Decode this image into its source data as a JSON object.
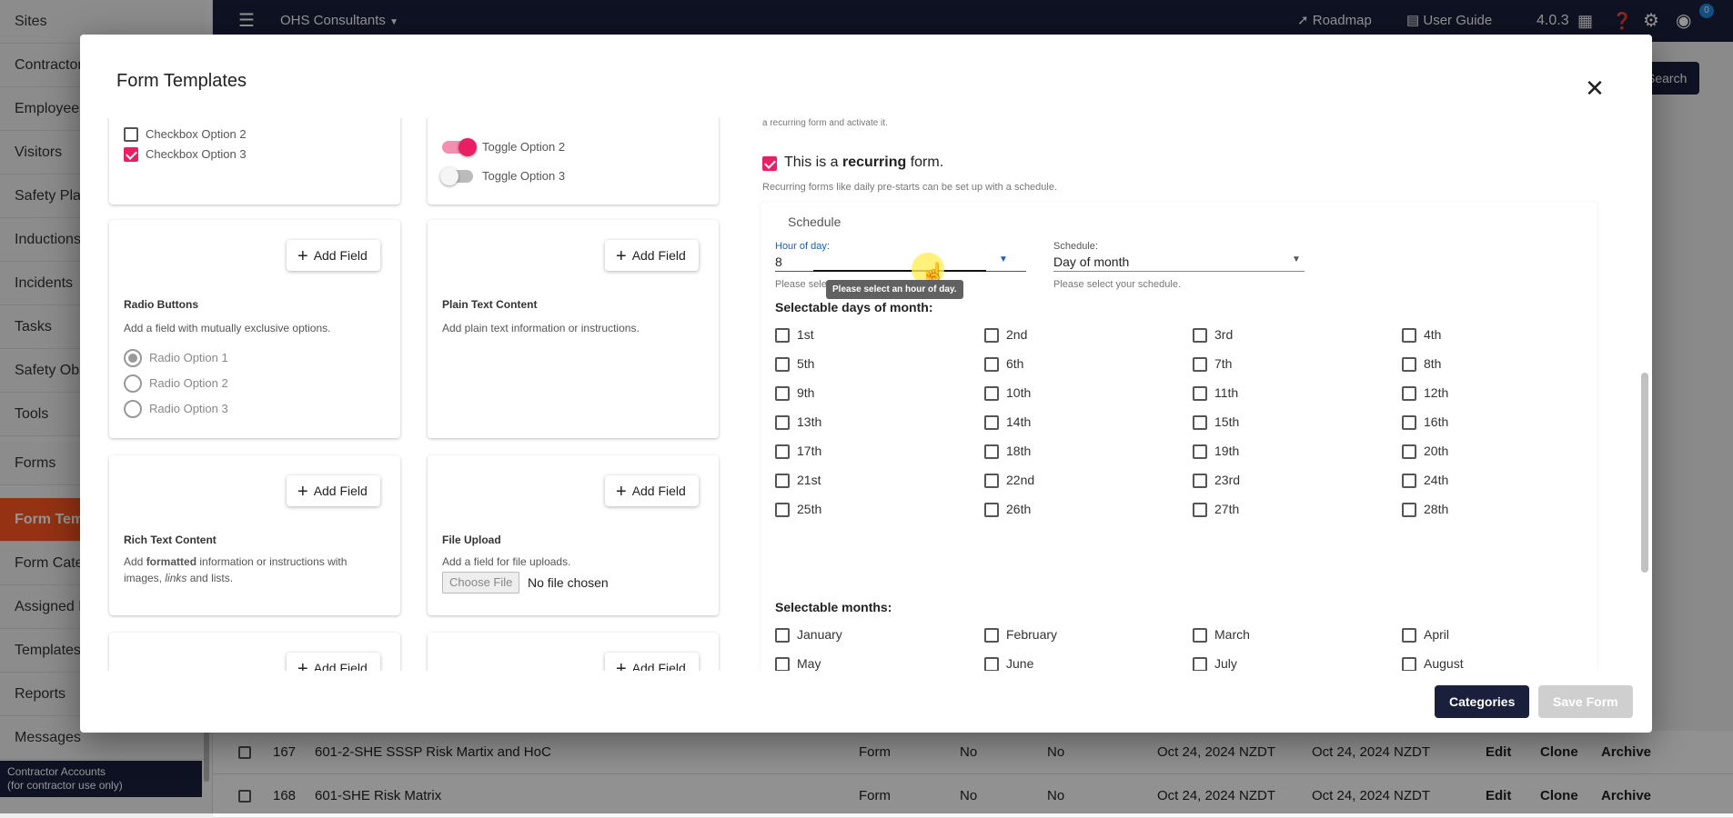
{
  "sidebar": {
    "items": [
      "Sites",
      "Contractors",
      "Employees",
      "Visitors",
      "Safety Plans",
      "Inductions",
      "Incidents",
      "Tasks",
      "Safety Observations",
      "Tools",
      "Forms",
      "Form Templates",
      "Form Categories",
      "Assigned Forms",
      "Templates",
      "Reports",
      "Messages"
    ],
    "active_index": 11,
    "footer_line1": "Contractor Accounts",
    "footer_line2": "(for contractor use only)"
  },
  "topbar": {
    "org": "OHS Consultants",
    "roadmap": "Roadmap",
    "user_guide": "User Guide",
    "version": "4.0.3",
    "badge": "0"
  },
  "background": {
    "search_button": "Search",
    "rows": [
      {
        "id": "167",
        "name": "601-2-SHE SSSP Risk Martix and HoC",
        "type": "Form",
        "col1": "No",
        "col2": "No",
        "created": "Oct 24, 2024 NZDT",
        "updated": "Oct 24, 2024 NZDT",
        "edit": "Edit",
        "clone": "Clone",
        "archive": "Archive"
      },
      {
        "id": "168",
        "name": "601-SHE Risk Matrix",
        "type": "Form",
        "col1": "No",
        "col2": "No",
        "created": "Oct 24, 2024 NZDT",
        "updated": "Oct 24, 2024 NZDT",
        "edit": "Edit",
        "clone": "Clone",
        "archive": "Archive"
      }
    ]
  },
  "modal": {
    "title": "Form Templates",
    "fields": {
      "checkbox_card": {
        "opt2": "Checkbox Option 2",
        "opt3": "Checkbox Option 3"
      },
      "toggle_card": {
        "opt2": "Toggle Option 2",
        "opt3": "Toggle Option 3"
      },
      "add_field": "Add Field",
      "radio": {
        "title": "Radio Buttons",
        "desc": "Add a field with mutually exclusive options.",
        "opts": [
          "Radio Option 1",
          "Radio Option 2",
          "Radio Option 3"
        ]
      },
      "plain": {
        "title": "Plain Text Content",
        "desc": "Add plain text information or instructions."
      },
      "rich": {
        "title": "Rich Text Content",
        "desc_pre": "Add ",
        "desc_bold": "formatted",
        "desc_mid": " information or instructions with images, ",
        "desc_em": "links",
        "desc_post": " and lists."
      },
      "upload": {
        "title": "File Upload",
        "desc": "Add a field for file uploads.",
        "choose": "Choose File",
        "none": "No file chosen"
      }
    },
    "settings": {
      "top_text": "a recurring form and activate it.",
      "recurring_pre": "This is a ",
      "recurring_bold": "recurring",
      "recurring_post": " form.",
      "recurring_help": "Recurring forms like daily pre-starts can be set up with a schedule.",
      "schedule_title": "Schedule",
      "hour_label": "Hour of day:",
      "hour_value": "8",
      "hour_helper": "Please select",
      "hour_tooltip": "Please select an hour of day.",
      "schedule_label": "Schedule:",
      "schedule_value": "Day of month",
      "schedule_helper": "Please select your schedule.",
      "days_heading": "Selectable days of month:",
      "days": [
        "1st",
        "2nd",
        "3rd",
        "4th",
        "5th",
        "6th",
        "7th",
        "8th",
        "9th",
        "10th",
        "11th",
        "12th",
        "13th",
        "14th",
        "15th",
        "16th",
        "17th",
        "18th",
        "19th",
        "20th",
        "21st",
        "22nd",
        "23rd",
        "24th",
        "25th",
        "26th",
        "27th",
        "28th"
      ],
      "months_heading": "Selectable months:",
      "months": [
        "January",
        "February",
        "March",
        "April",
        "May",
        "June",
        "July",
        "August"
      ]
    },
    "footer": {
      "categories": "Categories",
      "save": "Save Form"
    }
  }
}
